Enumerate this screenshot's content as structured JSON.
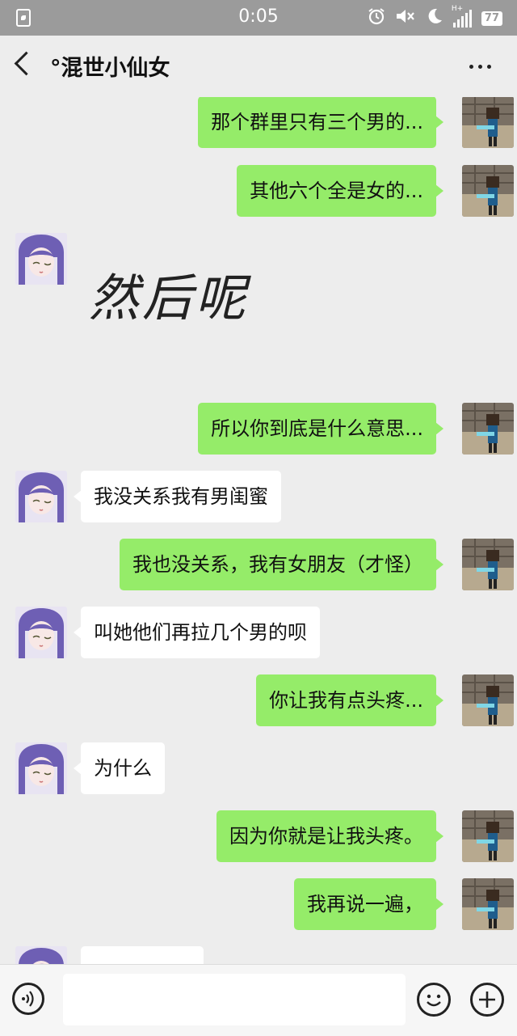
{
  "status_bar": {
    "time": "0:05",
    "icons": [
      "alarm-icon",
      "mute-icon",
      "moon-icon",
      "signal-icon"
    ],
    "network": "H+",
    "battery": "77"
  },
  "header": {
    "title": "°混世小仙女",
    "back_icon": "chevron-left-icon",
    "more_icon": "more-icon"
  },
  "colors": {
    "me_bubble": "#95ec69",
    "her_bubble": "#ffffff",
    "background": "#ededed"
  },
  "messages": [
    {
      "from": "me",
      "text": "那个群里只有三个男的..."
    },
    {
      "from": "me",
      "text": "其他六个全是女的..."
    },
    {
      "from": "her",
      "type": "sticker",
      "text": "然后呢"
    },
    {
      "from": "me",
      "text": "所以你到底是什么意思..."
    },
    {
      "from": "her",
      "text": "我没关系我有男闺蜜"
    },
    {
      "from": "me",
      "text": "我也没关系，我有女朋友（才怪）"
    },
    {
      "from": "her",
      "text": "叫她他们再拉几个男的呗"
    },
    {
      "from": "me",
      "text": "你让我有点头疼..."
    },
    {
      "from": "her",
      "text": "为什么"
    },
    {
      "from": "me",
      "text": "因为你就是让我头疼。"
    },
    {
      "from": "me",
      "text": "我再说一遍，"
    },
    {
      "from": "her",
      "text": ""
    }
  ],
  "input_bar": {
    "voice_icon": "voice-icon",
    "text_value": "",
    "emoji_icon": "emoji-icon",
    "plus_icon": "plus-icon"
  }
}
